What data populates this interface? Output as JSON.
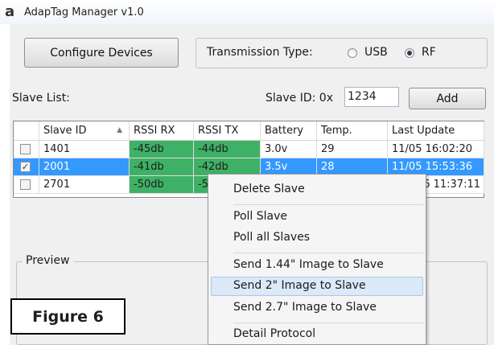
{
  "window": {
    "title": "AdapTag Manager  v1.0",
    "icon": "a"
  },
  "toolbar": {
    "configure_label": "Configure Devices",
    "transmission_label": "Transmission Type:",
    "usb_label": "USB",
    "rf_label": "RF",
    "selected_transmission": "RF"
  },
  "slave": {
    "list_label": "Slave List:",
    "id_label": "Slave ID: 0x",
    "id_value": "1234",
    "add_label": "Add"
  },
  "table": {
    "columns": [
      "Slave ID",
      "RSSI RX",
      "RSSI TX",
      "Battery",
      "Temp.",
      "Last Update"
    ],
    "sort_indicator": "▲",
    "rows": [
      {
        "checked": false,
        "selected": false,
        "cells": [
          "1401",
          "-45db",
          "-44db",
          "3.0v",
          "29",
          "11/05 16:02:20"
        ]
      },
      {
        "checked": true,
        "selected": true,
        "cells": [
          "2001",
          "-41db",
          "-42db",
          "3.5v",
          "28",
          "11/05 15:53:36"
        ]
      },
      {
        "checked": false,
        "selected": false,
        "cells": [
          "2701",
          "-50db",
          "-5",
          "",
          "",
          "06 11:37:11"
        ]
      }
    ],
    "rssi_color": "#3eb166",
    "selection_color": "#3399ff"
  },
  "preview": {
    "label": "Preview"
  },
  "context_menu": {
    "items": [
      "Delete Slave",
      "Poll Slave",
      "Poll all Slaves",
      "Send 1.44\" Image to Slave",
      "Send 2\" Image to Slave",
      "Send 2.7\" Image to Slave",
      "Detail Protocol"
    ],
    "hovered": "Send 2\" Image to Slave"
  },
  "figure_caption": "Figure 6"
}
